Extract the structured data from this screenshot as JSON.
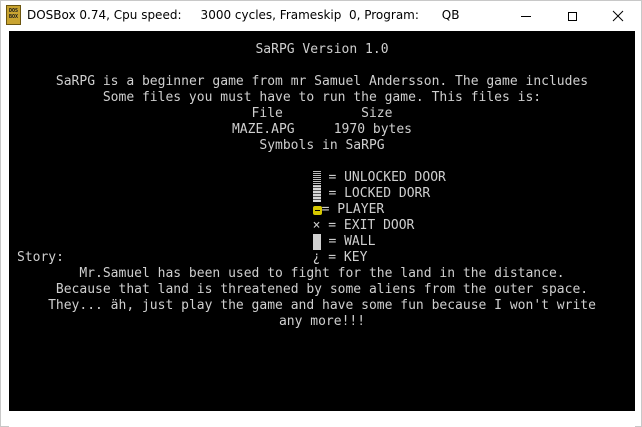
{
  "window": {
    "title": "DOSBox 0.74, Cpu speed:     3000 cycles, Frameskip  0, Program:      QB",
    "app_icon_text": "DOS BOX"
  },
  "screen": {
    "heading": "SaRPG Version 1.0",
    "intro_1": "SaRPG is a beginner game from mr Samuel Andersson. The game includes",
    "intro_2": "Some files you must have to run the game. This files is:",
    "file_header": "File          Size",
    "file_row": "MAZE.APG     1970 bytes",
    "symbols_heading": "Symbols in SaRPG",
    "symbols": [
      {
        "glyph": "",
        "text": " = UNLOCKED DOOR"
      },
      {
        "glyph": "",
        "text": " = LOCKED DORR"
      },
      {
        "glyph": "",
        "text": "= PLAYER"
      },
      {
        "glyph": "×",
        "text": " = EXIT DOOR"
      },
      {
        "glyph": "",
        "text": " = WALL"
      },
      {
        "glyph": "¿",
        "text": " = KEY"
      }
    ],
    "story_label": "Story:",
    "story_1": "Mr.Samuel has been used to fight for the land in the distance.",
    "story_2": "Because that land is threatened by some aliens from the outer space.",
    "story_3": "They... äh, just play the game and have some fun because I won't write",
    "story_4": "any more!!!"
  }
}
